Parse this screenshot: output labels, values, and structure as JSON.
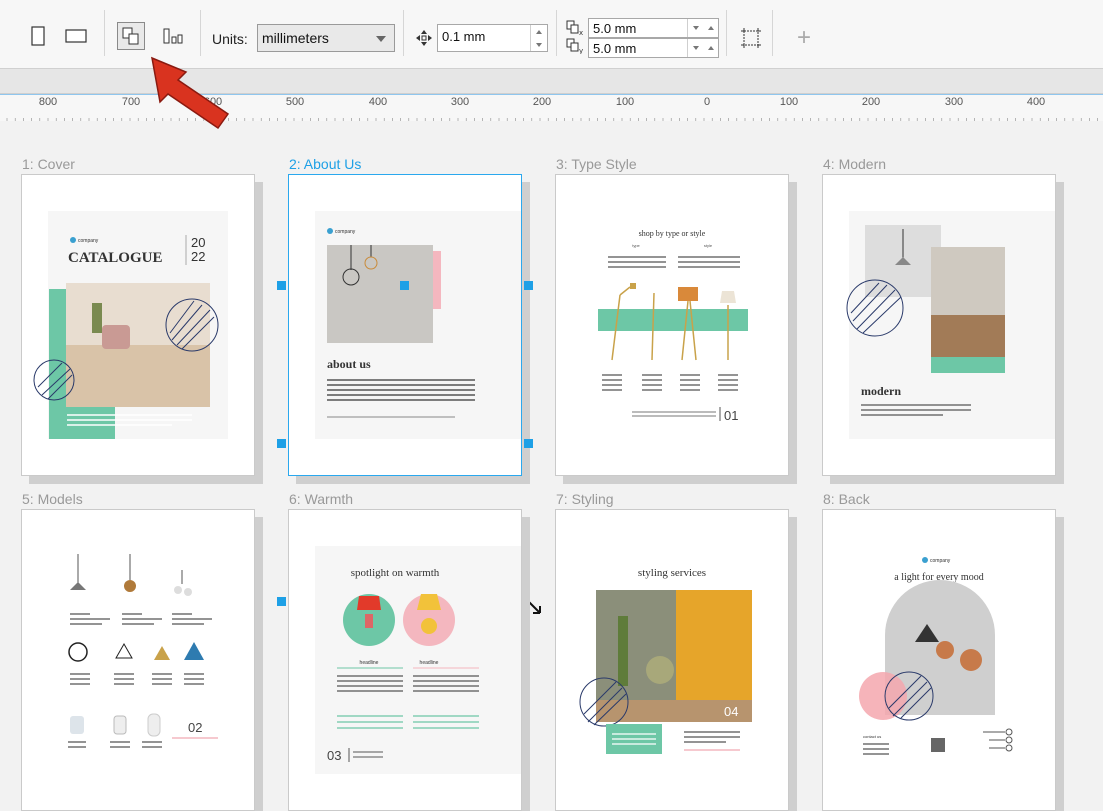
{
  "toolbar": {
    "units_label": "Units:",
    "units_value": "millimeters",
    "nudge_value": "0.1 mm",
    "dup_x_value": "5.0 mm",
    "dup_y_value": "5.0 mm",
    "add_label": "+"
  },
  "ruler": {
    "ticks": [
      "800",
      "700",
      "600",
      "500",
      "400",
      "300",
      "200",
      "100",
      "0",
      "100",
      "200",
      "300",
      "400"
    ]
  },
  "pages": [
    {
      "label": "1: Cover"
    },
    {
      "label": "2: About Us"
    },
    {
      "label": "3: Type Style"
    },
    {
      "label": "4: Modern"
    },
    {
      "label": "5: Models"
    },
    {
      "label": "6: Warmth"
    },
    {
      "label": "7: Styling"
    },
    {
      "label": "8: Back"
    }
  ],
  "thumbs": {
    "brand": "company",
    "cover_title": "CATALOGUE",
    "cover_year_top": "20",
    "cover_year_bottom": "22",
    "about_title": "about us",
    "type_title": "shop by type or style",
    "type_col_a": "type",
    "type_col_b": "style",
    "type_page_num": "01",
    "modern_title": "modern",
    "models_page_num": "02",
    "warmth_title": "spotlight on warmth",
    "warmth_head_a": "headline",
    "warmth_head_b": "headline",
    "warmth_page_num": "03",
    "styling_title": "styling services",
    "styling_page_num": "04",
    "back_title": "a light for every mood",
    "back_contact": "contact us"
  },
  "colors": {
    "accent_blue": "#1ea0e6",
    "green": "#6dc7a6",
    "pink": "#f4b7bf",
    "arrow_red": "#d9331f"
  }
}
